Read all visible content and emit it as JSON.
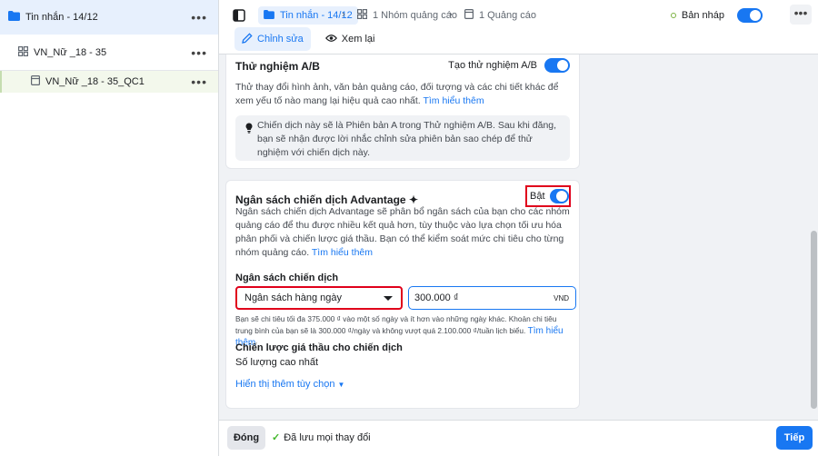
{
  "sidebar": {
    "items": [
      {
        "label": "Tin nhắn - 14/12",
        "icon": "folder-icon",
        "more": "•••"
      },
      {
        "label": "VN_Nữ _18 - 35",
        "icon": "adset-grid-icon",
        "more": "•••"
      },
      {
        "label": "VN_Nữ _18 - 35_QC1",
        "icon": "ad-page-icon",
        "more": "•••"
      }
    ]
  },
  "header": {
    "breadcrumbs": [
      {
        "label": "Tin nhắn - 14/12",
        "icon": "folder-icon"
      },
      {
        "label": "1 Nhóm quảng cáo",
        "icon": "adset-grid-icon"
      },
      {
        "label": "1 Quảng cáo",
        "icon": "ad-page-icon"
      }
    ],
    "draft_label": "Bản nháp",
    "more": "•••",
    "tabs": [
      {
        "label": "Chỉnh sửa",
        "icon": "pencil-icon"
      },
      {
        "label": "Xem lại",
        "icon": "eye-icon"
      }
    ]
  },
  "ab_test": {
    "title": "Thử nghiệm A/B",
    "toggle_label": "Tạo thử nghiệm A/B",
    "description": "Thử thay đổi hình ảnh, văn bản quảng cáo, đối tượng và các chi tiết khác để xem yếu tố nào mang lại hiệu quả cao nhất.",
    "link": "Tìm hiểu thêm",
    "info": "Chiến dịch này sẽ là Phiên bản A trong Thử nghiệm A/B. Sau khi đăng, bạn sẽ nhận được lời nhắc chỉnh sửa phiên bản sao chép để thử nghiệm với chiến dịch này."
  },
  "budget": {
    "title": "Ngân sách chiến dịch Advantage",
    "title_mark": "✦",
    "toggle_label": "Bật",
    "toggle_on": true,
    "description": "Ngân sách chiến dịch Advantage sẽ phân bổ ngân sách của bạn cho các nhóm quảng cáo để thu được nhiều kết quả hơn, tùy thuộc vào lựa chọn tối ưu hóa phân phối và chiến lược giá thầu. Bạn có thể kiểm soát mức chi tiêu cho từng nhóm quảng cáo.",
    "link": "Tìm hiểu thêm",
    "field_label": "Ngân sách chiến dịch",
    "budget_type": "Ngân sách hàng ngày",
    "amount": "300.000 ₫",
    "currency": "VND",
    "note": "Bạn sẽ chi tiêu tối đa 375.000 ₫ vào một số ngày và ít hơn vào những ngày khác. Khoản chi tiêu trung bình của bạn sẽ là 300.000 ₫/ngày và không vượt quá 2.100.000 ₫/tuần lịch biểu.",
    "note_link": "Tìm hiểu thêm",
    "bid_label": "Chiến lược giá thầu cho chiến dịch",
    "bid_value": "Số lượng cao nhất",
    "more_options": "Hiển thị thêm tùy chọn"
  },
  "footer": {
    "close_label": "Đóng",
    "saved_label": "Đã lưu mọi thay đổi",
    "next_label": "Tiếp"
  },
  "colors": {
    "accent": "#1877f2",
    "highlight": "#e0001b",
    "success": "#42b72a"
  }
}
